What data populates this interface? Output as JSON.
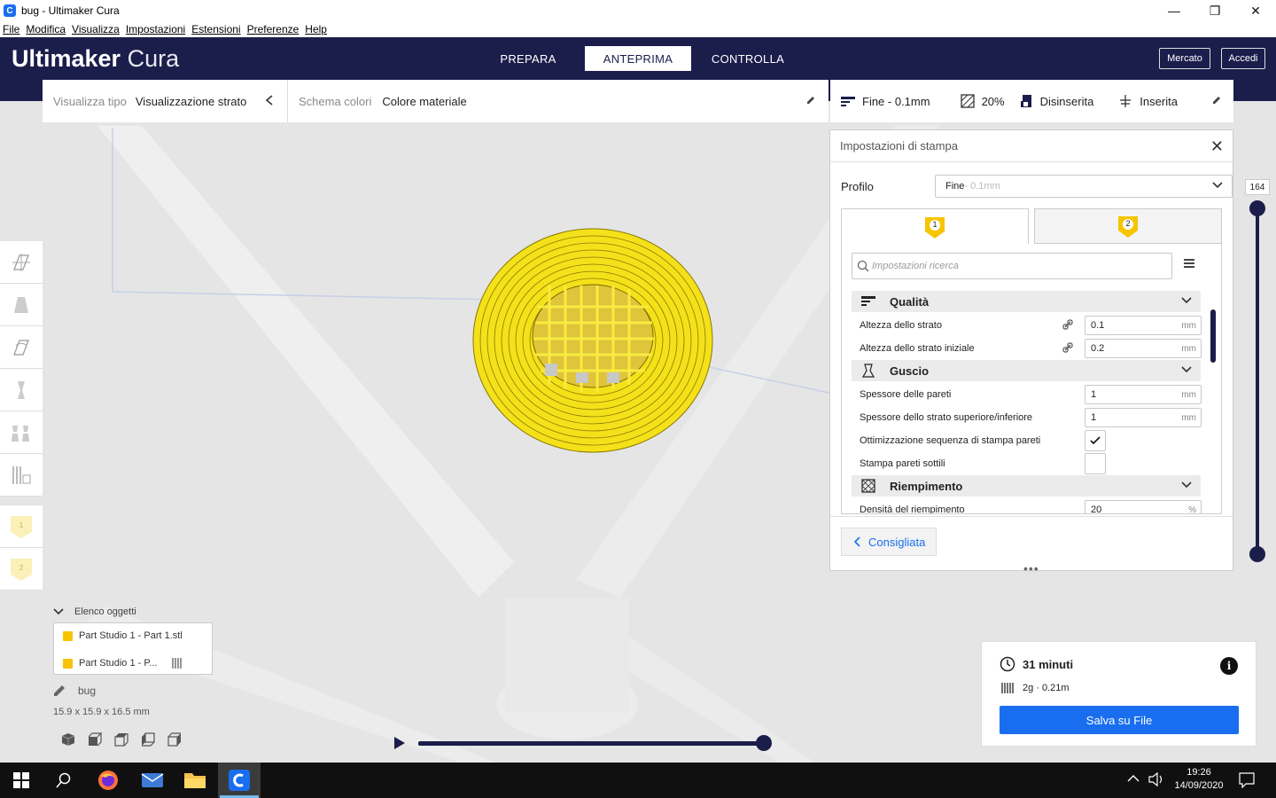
{
  "window": {
    "title": "bug - Ultimaker Cura",
    "minimize": "—",
    "restore": "❐",
    "close": "✕"
  },
  "menu": [
    "File",
    "Modifica",
    "Visualizza",
    "Impostazioni",
    "Estensioni",
    "Preferenze",
    "Help"
  ],
  "header": {
    "logo_bold": "Ultimaker",
    "logo_light": "Cura",
    "tabs": [
      {
        "label": "PREPARA",
        "active": false
      },
      {
        "label": "ANTEPRIMA",
        "active": true
      },
      {
        "label": "CONTROLLA",
        "active": false
      }
    ],
    "marketplace": "Mercato",
    "signin": "Accedi"
  },
  "view_toolbar": {
    "view_type_label": "Visualizza tipo",
    "view_type_value": "Visualizzazione strato",
    "color_scheme_label": "Schema colori",
    "color_scheme_value": "Colore materiale"
  },
  "print_summary": {
    "profile": "Fine - 0.1mm",
    "infill": "20%",
    "support": "Disinserita",
    "adhesion": "Inserita"
  },
  "print_settings": {
    "title": "Impostazioni di stampa",
    "profile_label": "Profilo",
    "profile_name": "Fine",
    "profile_sub": " - 0.1mm",
    "extruders": [
      "1",
      "2"
    ],
    "search_placeholder": "Impostazioni ricerca",
    "rows": {
      "quality": "Qualità",
      "layer_height": "Altezza dello strato",
      "layer_height_val": "0.1",
      "initial_layer": "Altezza dello strato iniziale",
      "initial_layer_val": "0.2",
      "shell": "Guscio",
      "wall_thickness": "Spessore delle pareti",
      "wall_thickness_val": "1",
      "top_bottom": "Spessore dello strato superiore/inferiore",
      "top_bottom_val": "1",
      "wall_order": "Ottimizzazione sequenza di stampa pareti",
      "thin_walls": "Stampa pareti sottili",
      "infill": "Riempimento",
      "infill_density": "Densità del riempimento",
      "infill_density_val": "20"
    },
    "unit_mm": "mm",
    "unit_pct": "%",
    "recommended_btn": "Consigliata",
    "drag_dots": "•••"
  },
  "layer_slider": {
    "max_label": "164"
  },
  "object_list": {
    "title": "Elenco oggetti",
    "items": [
      "Part Studio 1 - Part 1.stl",
      "Part Studio 1 - P..."
    ],
    "job_name": "bug",
    "dims": "15.9 x 15.9 x 16.5 mm"
  },
  "output": {
    "time": "31 minuti",
    "material": "2g · 0.21m",
    "save_button": "Salva su File"
  },
  "taskbar": {
    "time": "19:26",
    "date": "14/09/2020"
  },
  "colors": {
    "header": "#1b1d4b",
    "accent": "#196ef0",
    "model": "#f5e000",
    "extruder_flag": "#f6c500"
  }
}
